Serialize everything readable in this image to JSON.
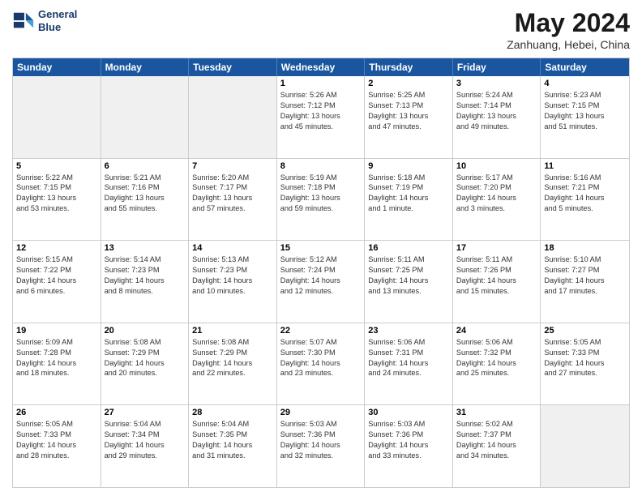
{
  "header": {
    "logo_line1": "General",
    "logo_line2": "Blue",
    "month": "May 2024",
    "location": "Zanhuang, Hebei, China"
  },
  "weekdays": [
    "Sunday",
    "Monday",
    "Tuesday",
    "Wednesday",
    "Thursday",
    "Friday",
    "Saturday"
  ],
  "rows": [
    [
      {
        "day": "",
        "lines": [],
        "shaded": true
      },
      {
        "day": "",
        "lines": [],
        "shaded": true
      },
      {
        "day": "",
        "lines": [],
        "shaded": true
      },
      {
        "day": "1",
        "lines": [
          "Sunrise: 5:26 AM",
          "Sunset: 7:12 PM",
          "Daylight: 13 hours",
          "and 45 minutes."
        ]
      },
      {
        "day": "2",
        "lines": [
          "Sunrise: 5:25 AM",
          "Sunset: 7:13 PM",
          "Daylight: 13 hours",
          "and 47 minutes."
        ]
      },
      {
        "day": "3",
        "lines": [
          "Sunrise: 5:24 AM",
          "Sunset: 7:14 PM",
          "Daylight: 13 hours",
          "and 49 minutes."
        ]
      },
      {
        "day": "4",
        "lines": [
          "Sunrise: 5:23 AM",
          "Sunset: 7:15 PM",
          "Daylight: 13 hours",
          "and 51 minutes."
        ]
      }
    ],
    [
      {
        "day": "5",
        "lines": [
          "Sunrise: 5:22 AM",
          "Sunset: 7:15 PM",
          "Daylight: 13 hours",
          "and 53 minutes."
        ]
      },
      {
        "day": "6",
        "lines": [
          "Sunrise: 5:21 AM",
          "Sunset: 7:16 PM",
          "Daylight: 13 hours",
          "and 55 minutes."
        ]
      },
      {
        "day": "7",
        "lines": [
          "Sunrise: 5:20 AM",
          "Sunset: 7:17 PM",
          "Daylight: 13 hours",
          "and 57 minutes."
        ]
      },
      {
        "day": "8",
        "lines": [
          "Sunrise: 5:19 AM",
          "Sunset: 7:18 PM",
          "Daylight: 13 hours",
          "and 59 minutes."
        ]
      },
      {
        "day": "9",
        "lines": [
          "Sunrise: 5:18 AM",
          "Sunset: 7:19 PM",
          "Daylight: 14 hours",
          "and 1 minute."
        ]
      },
      {
        "day": "10",
        "lines": [
          "Sunrise: 5:17 AM",
          "Sunset: 7:20 PM",
          "Daylight: 14 hours",
          "and 3 minutes."
        ]
      },
      {
        "day": "11",
        "lines": [
          "Sunrise: 5:16 AM",
          "Sunset: 7:21 PM",
          "Daylight: 14 hours",
          "and 5 minutes."
        ]
      }
    ],
    [
      {
        "day": "12",
        "lines": [
          "Sunrise: 5:15 AM",
          "Sunset: 7:22 PM",
          "Daylight: 14 hours",
          "and 6 minutes."
        ]
      },
      {
        "day": "13",
        "lines": [
          "Sunrise: 5:14 AM",
          "Sunset: 7:23 PM",
          "Daylight: 14 hours",
          "and 8 minutes."
        ]
      },
      {
        "day": "14",
        "lines": [
          "Sunrise: 5:13 AM",
          "Sunset: 7:23 PM",
          "Daylight: 14 hours",
          "and 10 minutes."
        ]
      },
      {
        "day": "15",
        "lines": [
          "Sunrise: 5:12 AM",
          "Sunset: 7:24 PM",
          "Daylight: 14 hours",
          "and 12 minutes."
        ]
      },
      {
        "day": "16",
        "lines": [
          "Sunrise: 5:11 AM",
          "Sunset: 7:25 PM",
          "Daylight: 14 hours",
          "and 13 minutes."
        ]
      },
      {
        "day": "17",
        "lines": [
          "Sunrise: 5:11 AM",
          "Sunset: 7:26 PM",
          "Daylight: 14 hours",
          "and 15 minutes."
        ]
      },
      {
        "day": "18",
        "lines": [
          "Sunrise: 5:10 AM",
          "Sunset: 7:27 PM",
          "Daylight: 14 hours",
          "and 17 minutes."
        ]
      }
    ],
    [
      {
        "day": "19",
        "lines": [
          "Sunrise: 5:09 AM",
          "Sunset: 7:28 PM",
          "Daylight: 14 hours",
          "and 18 minutes."
        ]
      },
      {
        "day": "20",
        "lines": [
          "Sunrise: 5:08 AM",
          "Sunset: 7:29 PM",
          "Daylight: 14 hours",
          "and 20 minutes."
        ]
      },
      {
        "day": "21",
        "lines": [
          "Sunrise: 5:08 AM",
          "Sunset: 7:29 PM",
          "Daylight: 14 hours",
          "and 22 minutes."
        ]
      },
      {
        "day": "22",
        "lines": [
          "Sunrise: 5:07 AM",
          "Sunset: 7:30 PM",
          "Daylight: 14 hours",
          "and 23 minutes."
        ]
      },
      {
        "day": "23",
        "lines": [
          "Sunrise: 5:06 AM",
          "Sunset: 7:31 PM",
          "Daylight: 14 hours",
          "and 24 minutes."
        ]
      },
      {
        "day": "24",
        "lines": [
          "Sunrise: 5:06 AM",
          "Sunset: 7:32 PM",
          "Daylight: 14 hours",
          "and 25 minutes."
        ]
      },
      {
        "day": "25",
        "lines": [
          "Sunrise: 5:05 AM",
          "Sunset: 7:33 PM",
          "Daylight: 14 hours",
          "and 27 minutes."
        ]
      }
    ],
    [
      {
        "day": "26",
        "lines": [
          "Sunrise: 5:05 AM",
          "Sunset: 7:33 PM",
          "Daylight: 14 hours",
          "and 28 minutes."
        ]
      },
      {
        "day": "27",
        "lines": [
          "Sunrise: 5:04 AM",
          "Sunset: 7:34 PM",
          "Daylight: 14 hours",
          "and 29 minutes."
        ]
      },
      {
        "day": "28",
        "lines": [
          "Sunrise: 5:04 AM",
          "Sunset: 7:35 PM",
          "Daylight: 14 hours",
          "and 31 minutes."
        ]
      },
      {
        "day": "29",
        "lines": [
          "Sunrise: 5:03 AM",
          "Sunset: 7:36 PM",
          "Daylight: 14 hours",
          "and 32 minutes."
        ]
      },
      {
        "day": "30",
        "lines": [
          "Sunrise: 5:03 AM",
          "Sunset: 7:36 PM",
          "Daylight: 14 hours",
          "and 33 minutes."
        ]
      },
      {
        "day": "31",
        "lines": [
          "Sunrise: 5:02 AM",
          "Sunset: 7:37 PM",
          "Daylight: 14 hours",
          "and 34 minutes."
        ]
      },
      {
        "day": "",
        "lines": [],
        "shaded": true
      }
    ]
  ]
}
